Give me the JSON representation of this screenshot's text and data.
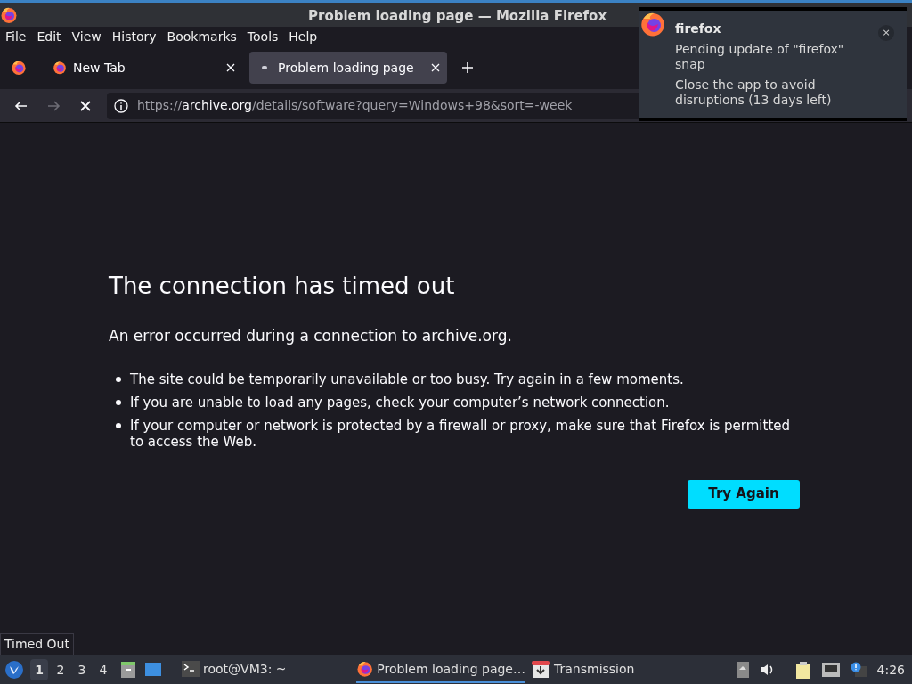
{
  "window": {
    "title": "Problem loading page — Mozilla Firefox"
  },
  "menu": [
    {
      "label": "File"
    },
    {
      "label": "Edit"
    },
    {
      "label": "View"
    },
    {
      "label": "History"
    },
    {
      "label": "Bookmarks"
    },
    {
      "label": "Tools"
    },
    {
      "label": "Help"
    }
  ],
  "tabs": [
    {
      "label": "New Tab",
      "selected": false,
      "loading": false
    },
    {
      "label": "Problem loading page",
      "selected": true,
      "loading": true
    }
  ],
  "nav": {
    "back_disabled": false,
    "forward_disabled": true,
    "url_scheme": "https://",
    "url_host": "archive.org",
    "url_path": "/details/software?query=Windows+98&sort=-week"
  },
  "error": {
    "title": "The connection has timed out",
    "intro": "An error occurred during a connection to archive.org.",
    "bullets": [
      "The site could be temporarily unavailable or too busy. Try again in a few moments.",
      "If you are unable to load any pages, check your computer’s network connection.",
      "If your computer or network is protected by a firewall or proxy, make sure that Firefox is permitted to access the Web."
    ],
    "button": "Try Again"
  },
  "status_tooltip": "Timed Out",
  "notification": {
    "app": "firefox",
    "message": "Pending update of \"firefox\" snap",
    "detail": "Close the app to avoid disruptions (13 days left)",
    "close": "×"
  },
  "taskbar": {
    "workspaces": [
      {
        "label": "1",
        "selected": true
      },
      {
        "label": "2",
        "selected": false
      },
      {
        "label": "3",
        "selected": false
      },
      {
        "label": "4",
        "selected": false
      }
    ],
    "tasks": [
      {
        "kind": "terminal",
        "label": "root@VM3: ~",
        "selected": false
      },
      {
        "kind": "firefox",
        "label": "Problem loading page…",
        "selected": true
      },
      {
        "kind": "transmission",
        "label": "Transmission",
        "selected": false
      }
    ],
    "clock": "4:26"
  }
}
